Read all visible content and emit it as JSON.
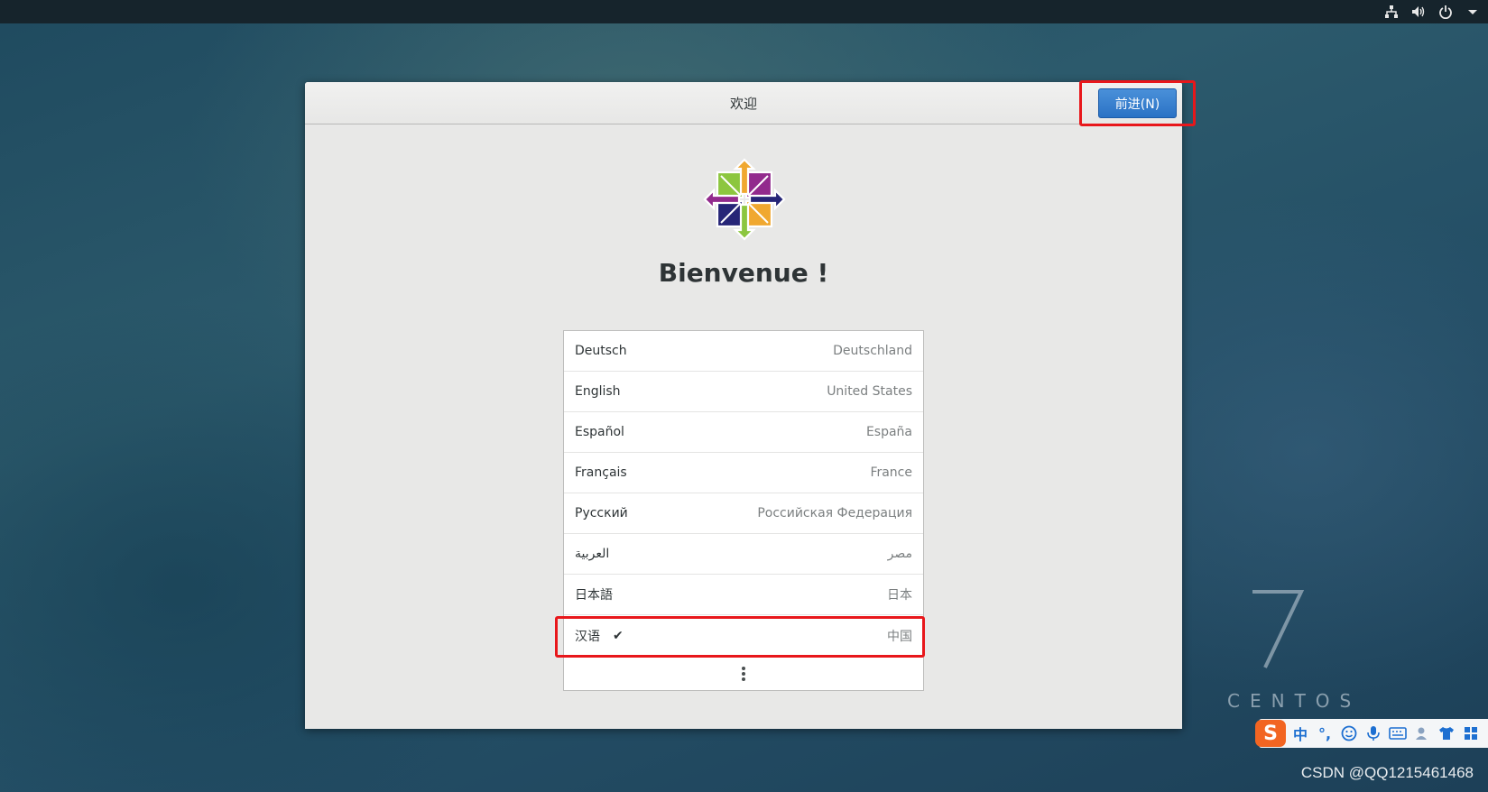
{
  "header": {
    "title": "欢迎",
    "next_label": "前进(N)"
  },
  "main": {
    "heading": "Bienvenue !",
    "languages": [
      {
        "name": "Deutsch",
        "region": "Deutschland",
        "selected": false
      },
      {
        "name": "English",
        "region": "United States",
        "selected": false
      },
      {
        "name": "Español",
        "region": "España",
        "selected": false
      },
      {
        "name": "Français",
        "region": "France",
        "selected": false
      },
      {
        "name": "Русский",
        "region": "Российская Федерация",
        "selected": false
      },
      {
        "name": "العربية",
        "region": "مصر",
        "selected": false
      },
      {
        "name": "日本語",
        "region": "日本",
        "selected": false
      },
      {
        "name": "汉语",
        "region": "中国",
        "selected": true
      }
    ],
    "check_mark": "✔"
  },
  "desktop": {
    "os_version": "7",
    "os_name": "CENTOS",
    "watermark": "CSDN @QQ1215461468"
  },
  "ime": {
    "logo": "S",
    "mode": "中",
    "punct": "°,",
    "icons": [
      "emoji-icon",
      "microphone-icon",
      "keyboard-icon",
      "user-icon",
      "skin-icon",
      "grid-icon"
    ]
  },
  "tray": {
    "icons": [
      "network-icon",
      "volume-icon",
      "power-icon",
      "chevron-down-icon"
    ]
  },
  "colors": {
    "accent": "#2a72c5",
    "highlight": "#e8171b",
    "logo_green": "#8cc63f",
    "logo_purple": "#922a8d",
    "logo_orange": "#f0a830",
    "logo_navy": "#262577"
  }
}
